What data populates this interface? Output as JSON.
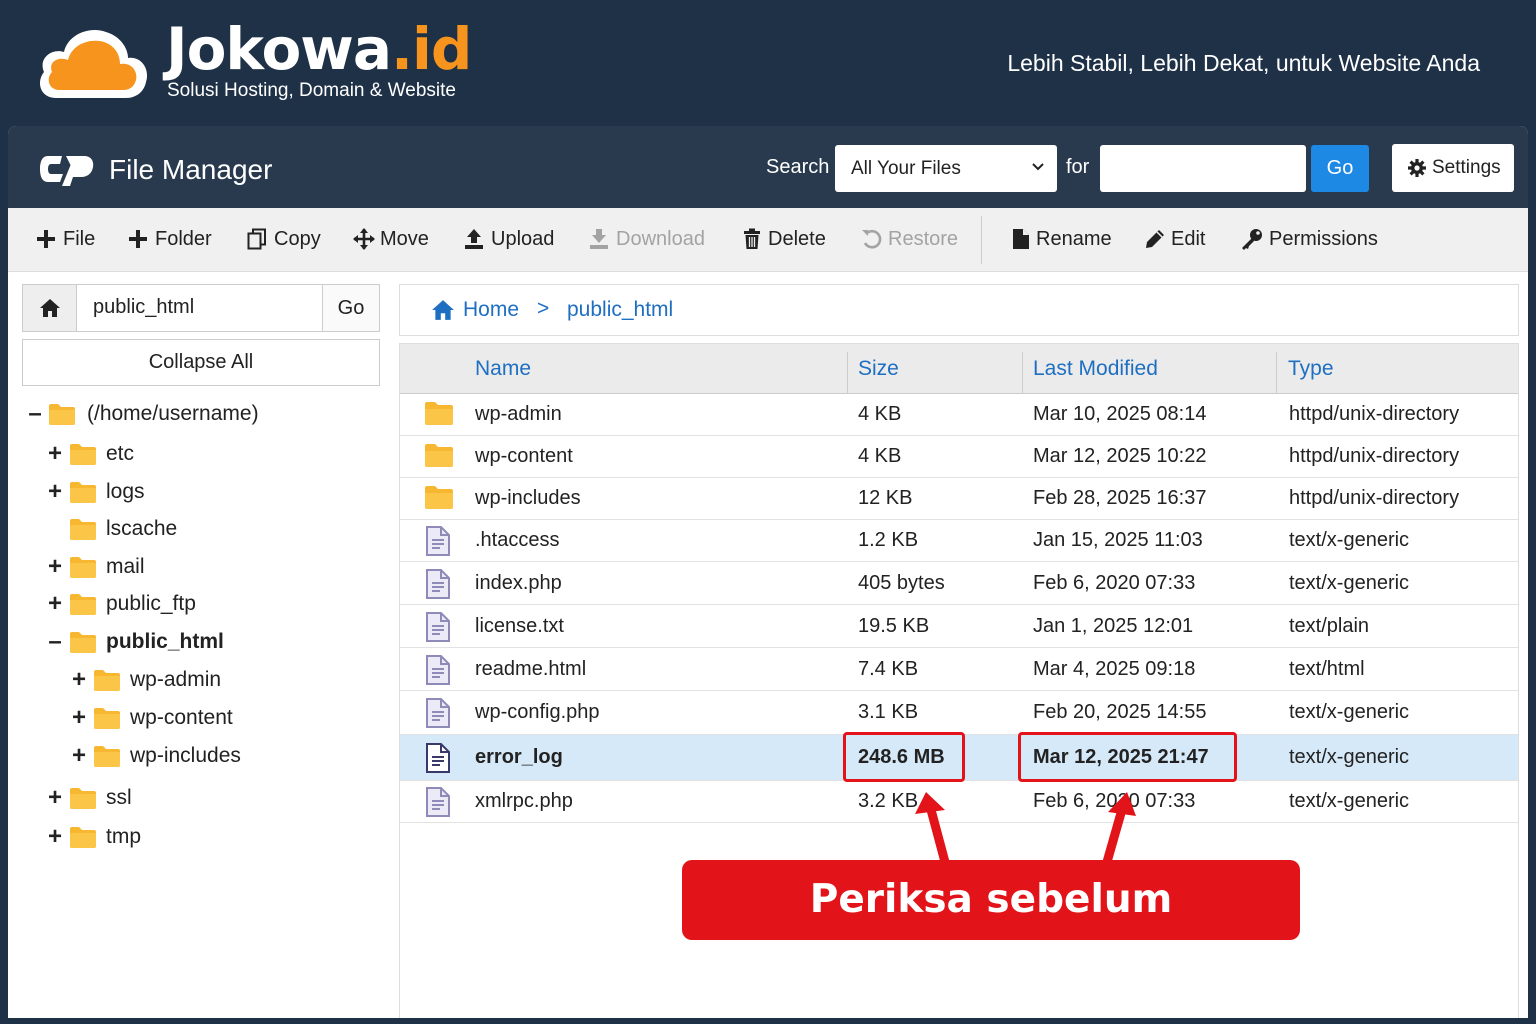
{
  "brand": {
    "name": "Jokowa",
    "tld": ".id",
    "subtitle": "Solusi Hosting, Domain & Website",
    "tagline": "Lebih Stabil, Lebih Dekat, untuk Website Anda",
    "accent_color": "#f7941d"
  },
  "app": {
    "title": "File Manager",
    "logo_icon": "cpanel-logo-icon",
    "search_label": "Search",
    "search_scope": "All Your Files",
    "for_label": "for",
    "search_query": "",
    "search_go": "Go",
    "settings_label": "Settings"
  },
  "toolbar": {
    "file": "File",
    "folder": "Folder",
    "copy": "Copy",
    "move": "Move",
    "upload": "Upload",
    "download": "Download",
    "delete": "Delete",
    "restore": "Restore",
    "rename": "Rename",
    "edit": "Edit",
    "permissions": "Permissions"
  },
  "sidebar": {
    "path_value": "public_html",
    "path_go": "Go",
    "collapse_all": "Collapse All",
    "tree": [
      {
        "label": "(/home/username)",
        "toggle": "–",
        "level": 0
      },
      {
        "label": "etc",
        "toggle": "+",
        "level": 1
      },
      {
        "label": "logs",
        "toggle": "+",
        "level": 1
      },
      {
        "label": "lscache",
        "toggle": "",
        "level": 1
      },
      {
        "label": "mail",
        "toggle": "+",
        "level": 1
      },
      {
        "label": "public_ftp",
        "toggle": "+",
        "level": 1
      },
      {
        "label": "public_html",
        "toggle": "–",
        "level": 1,
        "active": true
      },
      {
        "label": "wp-admin",
        "toggle": "+",
        "level": 2
      },
      {
        "label": "wp-content",
        "toggle": "+",
        "level": 2
      },
      {
        "label": "wp-includes",
        "toggle": "+",
        "level": 2
      },
      {
        "label": "ssl",
        "toggle": "+",
        "level": 1
      },
      {
        "label": "tmp",
        "toggle": "+",
        "level": 1
      }
    ]
  },
  "breadcrumb": {
    "home": "Home",
    "separator": ">",
    "current": "public_html"
  },
  "table": {
    "columns": [
      "Name",
      "Size",
      "Last Modified",
      "Type"
    ],
    "rows": [
      {
        "name": "wp-admin",
        "size": "4 KB",
        "modified": "Mar 10, 2025 08:14",
        "type": "httpd/unix-directory",
        "icon": "folder-icon"
      },
      {
        "name": "wp-content",
        "size": "4 KB",
        "modified": "Mar 12, 2025 10:22",
        "type": "httpd/unix-directory",
        "icon": "folder-icon"
      },
      {
        "name": "wp-includes",
        "size": "12 KB",
        "modified": "Feb 28, 2025 16:37",
        "type": "httpd/unix-directory",
        "icon": "folder-icon"
      },
      {
        "name": ".htaccess",
        "size": "1.2 KB",
        "modified": "Jan 15, 2025 11:03",
        "type": "text/x-generic",
        "icon": "file-icon"
      },
      {
        "name": "index.php",
        "size": "405 bytes",
        "modified": "Feb 6, 2020 07:33",
        "type": "text/x-generic",
        "icon": "file-icon"
      },
      {
        "name": "license.txt",
        "size": "19.5 KB",
        "modified": "Jan 1, 2025 12:01",
        "type": "text/plain",
        "icon": "file-icon"
      },
      {
        "name": "readme.html",
        "size": "7.4 KB",
        "modified": "Mar 4, 2025 09:18",
        "type": "text/html",
        "icon": "file-icon"
      },
      {
        "name": "wp-config.php",
        "size": "3.1 KB",
        "modified": "Feb 20, 2025 14:55",
        "type": "text/x-generic",
        "icon": "file-icon"
      },
      {
        "name": "error_log",
        "size": "248.6 MB",
        "modified": "Mar 12, 2025 21:47",
        "type": "text/x-generic",
        "icon": "file-icon",
        "selected": true
      },
      {
        "name": "xmlrpc.php",
        "size": "3.2 KB",
        "modified": "Feb 6, 2020 07:33",
        "type": "text/x-generic",
        "icon": "file-icon"
      }
    ]
  },
  "annotation": {
    "callout_text": "Periksa sebelum menghapus",
    "color": "#e3131a"
  }
}
